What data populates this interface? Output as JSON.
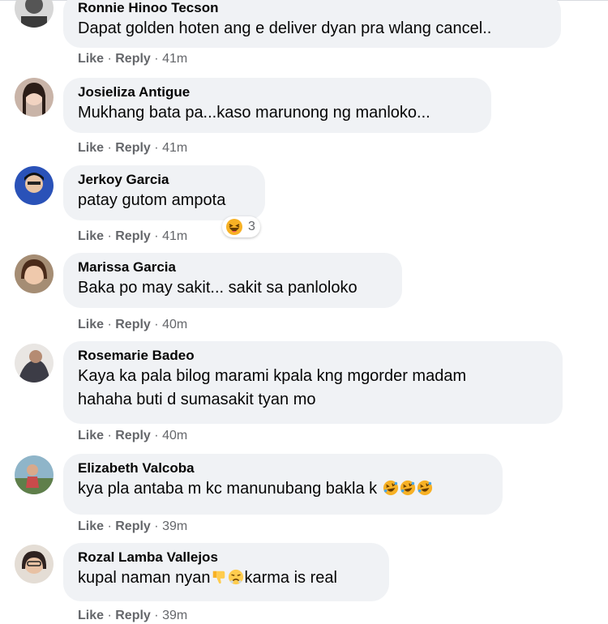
{
  "actions": {
    "like": "Like",
    "reply": "Reply",
    "sep": "·"
  },
  "colors": {
    "bubble": "#f0f2f5",
    "meta": "#65676b",
    "text": "#050505"
  },
  "comments": [
    {
      "name": "Ronnie Hinoo Tecson",
      "lines": [
        "Dapat golden hoten ang e deliver dyan pra wlang cancel.."
      ],
      "time": "41m",
      "avatar": "avatar-photo"
    },
    {
      "name": "Josieliza Antigue",
      "lines": [
        "Mukhang bata pa...kaso marunong ng manloko..."
      ],
      "time": "41m",
      "avatar": "avatar-photo"
    },
    {
      "name": "Jerkoy Garcia",
      "lines": [
        "patay gutom ampota"
      ],
      "time": "41m",
      "avatar": "avatar-photo",
      "reaction": {
        "icon": "haha-reaction-icon",
        "count": "3"
      }
    },
    {
      "name": "Marissa Garcia",
      "lines": [
        "Baka po may sakit... sakit sa panloloko"
      ],
      "time": "40m",
      "avatar": "avatar-photo"
    },
    {
      "name": "Rosemarie Badeo",
      "lines": [
        "Kaya ka pala bilog marami kpala kng mgorder madam",
        "hahaha buti d sumasakit tyan mo"
      ],
      "time": "40m",
      "avatar": "avatar-photo"
    },
    {
      "name": "Elizabeth Valcoba",
      "lines": [
        "kya pla antaba m kc manunubang bakla k"
      ],
      "time": "39m",
      "avatar": "avatar-photo",
      "emojis": [
        "rofl-emoji-icon",
        "rofl-emoji-icon",
        "rofl-emoji-icon"
      ]
    },
    {
      "name": "Rozal Lamba Vallejos",
      "lines": [
        "kupal naman nyan"
      ],
      "lines_after": "karma is real",
      "time": "39m",
      "avatar": "avatar-photo",
      "emojis": [
        "thumbs-down-emoji-icon",
        "angry-face-emoji-icon"
      ]
    }
  ]
}
